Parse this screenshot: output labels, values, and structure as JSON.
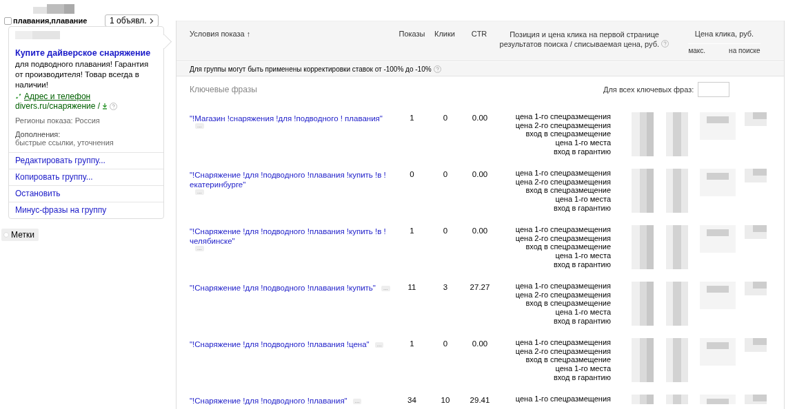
{
  "group": {
    "checked": false,
    "name": "плавания,плавание",
    "ads_button": "1 объявл.",
    "ad": {
      "title": "Купите дайверское снаряжение",
      "text": "для подводного плавания! Гарантия от производителя! Товар всегда в наличии!",
      "contact_link": "Адрес и телефон",
      "url": "divers.ru/снаряжение /",
      "regions": "Регионы показа: Россия",
      "extras_label": "Дополнения:",
      "extras": "быстрые ссылки, уточнения"
    },
    "actions": [
      "Редактировать группу...",
      "Копировать группу...",
      "Остановить",
      "Минус-фразы на группу"
    ],
    "tags_button": "Метки"
  },
  "table": {
    "columns": {
      "condition": "Условия показа ↑",
      "shows": "Показы",
      "clicks": "Клики",
      "ctr": "CTR",
      "position": "Позиция и цена клика на первой странице результатов поиска / списываемая цена, руб.",
      "price": "Цена клика, руб.",
      "price_max": "макс.",
      "price_search": "на поиске"
    },
    "notice": "Для группы могут быть применены корректировки ставок от -100% до -10%",
    "section": "Ключевые фразы",
    "all_label": "Для всех ключевых фраз:",
    "rows": [
      {
        "phrase": "\"!Магазин !снаряжения !для !подводного ! плавания\"",
        "more": "...",
        "shows": "1",
        "clicks": "0",
        "ctr": "0.00",
        "labels": [
          "цена 1-го спецразмещения",
          "цена 2-го спецразмещения",
          "вход в спецразмещение",
          "цена 1-го места",
          "вход в гарантию"
        ]
      },
      {
        "phrase": "\"!Снаряжение !для !подводного !плавания !купить !в ! екатеринбурге\"",
        "more": "...",
        "shows": "0",
        "clicks": "0",
        "ctr": "0.00",
        "labels": [
          "цена 1-го спецразмещения",
          "цена 2-го спецразмещения",
          "вход в спецразмещение",
          "цена 1-го места",
          "вход в гарантию"
        ]
      },
      {
        "phrase": "\"!Снаряжение !для !подводного !плавания !купить !в ! челябинске\"",
        "more": "...",
        "shows": "1",
        "clicks": "0",
        "ctr": "0.00",
        "labels": [
          "цена 1-го спецразмещения",
          "цена 2-го спецразмещения",
          "вход в спецразмещение",
          "цена 1-го места",
          "вход в гарантию"
        ]
      },
      {
        "phrase": "\"!Снаряжение !для !подводного !плавания !купить\"",
        "more": "...",
        "shows": "11",
        "clicks": "3",
        "ctr": "27.27",
        "labels": [
          "цена 1-го спецразмещения",
          "цена 2-го спецразмещения",
          "вход в спецразмещение",
          "цена 1-го места",
          "вход в гарантию"
        ]
      },
      {
        "phrase": "\"!Снаряжение !для !подводного !плавания !цена\"",
        "more": "...",
        "shows": "1",
        "clicks": "0",
        "ctr": "0.00",
        "labels": [
          "цена 1-го спецразмещения",
          "цена 2-го спецразмещения",
          "вход в спецразмещение",
          "цена 1-го места",
          "вход в гарантию"
        ]
      },
      {
        "phrase": "\"!Снаряжение !для !подводного !плавания\"",
        "more": "...",
        "shows": "34",
        "clicks": "10",
        "ctr": "29.41",
        "labels": [
          "цена 1-го спецразмещения"
        ]
      }
    ]
  }
}
